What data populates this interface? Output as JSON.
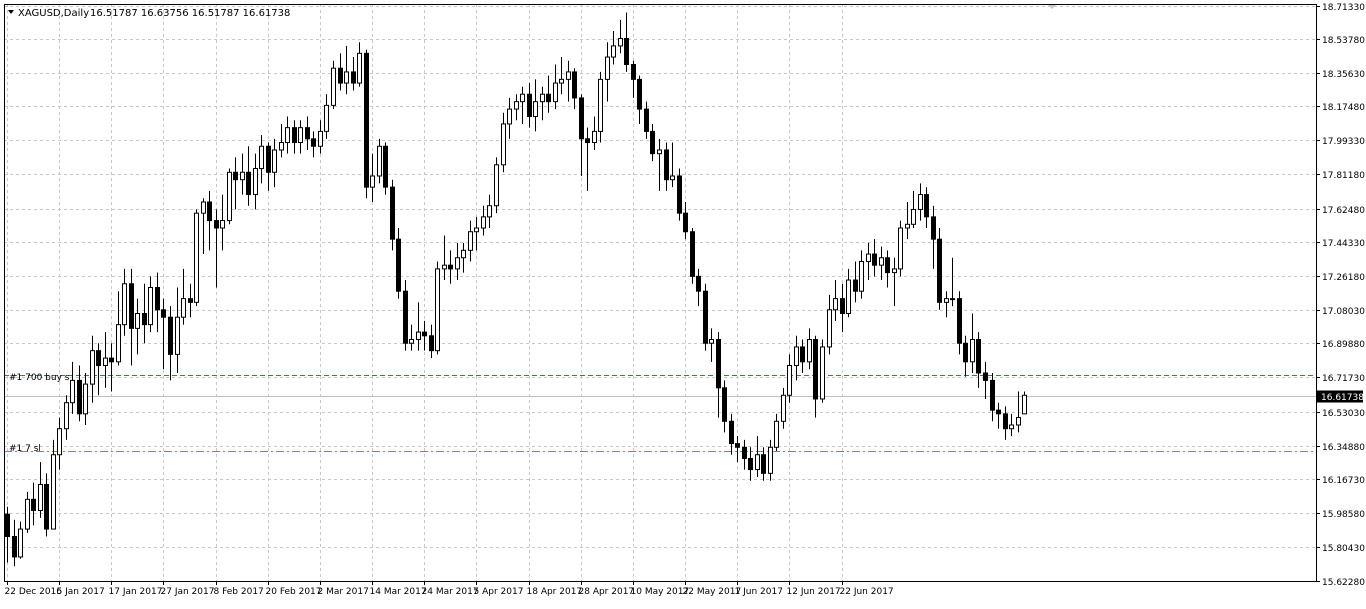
{
  "header": {
    "symbol": "XAGUSD,Daily",
    "ohlc": "16.51787 16.63756 16.51787 16.61738"
  },
  "orders": {
    "buy_label": "#1 700 buy s",
    "sl_label": "#1 7 sl",
    "buy_price": 16.7265,
    "sl_price": 16.3185
  },
  "colors": {
    "background": "#ffffff",
    "grid": "#c8c8c8",
    "bull_body": "#ffffff",
    "bear_body": "#000000",
    "wick": "#000000",
    "buy_line": "#2e8b2e",
    "sl_line": "#e0603a",
    "current_price_line": "#c0c0c0",
    "price_tag_bg": "#000000",
    "price_tag_text": "#ffffff"
  },
  "chart_data": {
    "type": "candlestick",
    "symbol": "XAGUSD",
    "timeframe": "Daily",
    "ylim": [
      15.6205,
      18.7255
    ],
    "y_ticks": [
      "18.71330",
      "18.53780",
      "18.35630",
      "18.17480",
      "17.99330",
      "17.81180",
      "17.62480",
      "17.44330",
      "17.26180",
      "17.08030",
      "16.89880",
      "16.71730",
      "16.53030",
      "16.34880",
      "16.16730",
      "15.98580",
      "15.80430",
      "15.62280"
    ],
    "x_ticks": [
      "22 Dec 2016",
      "5 Jan 2017",
      "17 Jan 2017",
      "27 Jan 2017",
      "8 Feb 2017",
      "20 Feb 2017",
      "2 Mar 2017",
      "14 Mar 2017",
      "24 Mar 2017",
      "5 Apr 2017",
      "18 Apr 2017",
      "28 Apr 2017",
      "10 May 2017",
      "22 May 2017",
      "1 Jun 2017",
      "12 Jun 2017",
      "22 Jun 2017"
    ],
    "current_price": "16.61738",
    "grid": true,
    "series": [
      {
        "candles": [
          [
            15.98,
            15.86,
            16.02,
            15.72
          ],
          [
            15.86,
            15.75,
            15.95,
            15.7
          ],
          [
            15.75,
            15.9,
            15.94,
            15.74
          ],
          [
            15.9,
            16.06,
            16.1,
            15.88
          ],
          [
            16.06,
            16.0,
            16.15,
            15.92
          ],
          [
            16.0,
            16.14,
            16.26,
            15.96
          ],
          [
            16.14,
            15.9,
            16.2,
            15.86
          ],
          [
            15.9,
            16.3,
            16.38,
            15.9
          ],
          [
            16.3,
            16.44,
            16.5,
            16.22
          ],
          [
            16.44,
            16.58,
            16.62,
            16.38
          ],
          [
            16.58,
            16.7,
            16.8,
            16.52
          ],
          [
            16.7,
            16.52,
            16.78,
            16.48
          ],
          [
            16.52,
            16.68,
            16.74,
            16.46
          ],
          [
            16.68,
            16.86,
            16.94,
            16.58
          ],
          [
            16.86,
            16.78,
            16.9,
            16.62
          ],
          [
            16.78,
            16.82,
            16.96,
            16.66
          ],
          [
            16.82,
            16.8,
            16.9,
            16.64
          ],
          [
            16.8,
            17.0,
            17.18,
            16.78
          ],
          [
            17.0,
            17.22,
            17.3,
            16.94
          ],
          [
            17.22,
            16.98,
            17.3,
            16.78
          ],
          [
            16.98,
            17.06,
            17.14,
            16.84
          ],
          [
            17.06,
            17.0,
            17.22,
            16.9
          ],
          [
            17.0,
            17.2,
            17.26,
            16.96
          ],
          [
            17.2,
            17.08,
            17.28,
            16.96
          ],
          [
            17.08,
            17.04,
            17.14,
            16.76
          ],
          [
            17.04,
            16.84,
            17.1,
            16.7
          ],
          [
            16.84,
            17.04,
            17.2,
            16.74
          ],
          [
            17.04,
            17.14,
            17.3,
            17.0
          ],
          [
            17.14,
            17.12,
            17.22,
            17.04
          ],
          [
            17.12,
            17.6,
            17.62,
            17.1
          ],
          [
            17.6,
            17.66,
            17.68,
            17.38
          ],
          [
            17.66,
            17.56,
            17.72,
            17.4
          ],
          [
            17.56,
            17.52,
            17.62,
            17.2
          ],
          [
            17.52,
            17.56,
            17.7,
            17.4
          ],
          [
            17.56,
            17.82,
            17.84,
            17.54
          ],
          [
            17.82,
            17.78,
            17.9,
            17.62
          ],
          [
            17.78,
            17.82,
            17.92,
            17.7
          ],
          [
            17.82,
            17.7,
            17.96,
            17.64
          ],
          [
            17.7,
            17.84,
            17.92,
            17.62
          ],
          [
            17.84,
            17.96,
            18.02,
            17.76
          ],
          [
            17.96,
            17.82,
            17.98,
            17.72
          ],
          [
            17.82,
            17.94,
            18.0,
            17.74
          ],
          [
            17.94,
            17.98,
            18.08,
            17.9
          ],
          [
            17.98,
            18.06,
            18.12,
            17.92
          ],
          [
            18.06,
            17.98,
            18.1,
            17.92
          ],
          [
            17.98,
            18.06,
            18.1,
            17.92
          ],
          [
            18.06,
            18.0,
            18.12,
            17.94
          ],
          [
            18.0,
            17.96,
            18.04,
            17.9
          ],
          [
            17.96,
            18.04,
            18.1,
            17.92
          ],
          [
            18.04,
            18.18,
            18.24,
            18.0
          ],
          [
            18.18,
            18.38,
            18.42,
            18.16
          ],
          [
            18.38,
            18.3,
            18.46,
            18.26
          ],
          [
            18.3,
            18.36,
            18.5,
            18.24
          ],
          [
            18.36,
            18.3,
            18.44,
            18.26
          ],
          [
            18.3,
            18.46,
            18.52,
            18.28
          ],
          [
            18.46,
            17.74,
            18.48,
            17.68
          ],
          [
            17.74,
            17.8,
            17.92,
            17.66
          ],
          [
            17.8,
            17.96,
            18.0,
            17.76
          ],
          [
            17.96,
            17.74,
            17.98,
            17.7
          ],
          [
            17.74,
            17.46,
            17.78,
            17.4
          ],
          [
            17.46,
            17.18,
            17.52,
            17.14
          ],
          [
            17.18,
            16.9,
            17.24,
            16.86
          ],
          [
            16.9,
            16.92,
            17.0,
            16.86
          ],
          [
            16.92,
            16.96,
            17.12,
            16.86
          ],
          [
            16.96,
            16.94,
            17.02,
            16.86
          ],
          [
            16.94,
            16.86,
            17.0,
            16.82
          ],
          [
            16.86,
            17.3,
            17.34,
            16.84
          ],
          [
            17.3,
            17.32,
            17.48,
            17.24
          ],
          [
            17.32,
            17.3,
            17.4,
            17.22
          ],
          [
            17.3,
            17.36,
            17.44,
            17.24
          ],
          [
            17.36,
            17.4,
            17.44,
            17.28
          ],
          [
            17.4,
            17.5,
            17.56,
            17.34
          ],
          [
            17.5,
            17.52,
            17.58,
            17.4
          ],
          [
            17.52,
            17.58,
            17.64,
            17.48
          ],
          [
            17.58,
            17.64,
            17.7,
            17.52
          ],
          [
            17.64,
            17.86,
            17.9,
            17.6
          ],
          [
            17.86,
            18.08,
            18.14,
            17.82
          ],
          [
            18.08,
            18.16,
            18.22,
            18.0
          ],
          [
            18.16,
            18.2,
            18.24,
            18.1
          ],
          [
            18.2,
            18.24,
            18.28,
            18.08
          ],
          [
            18.24,
            18.12,
            18.3,
            18.06
          ],
          [
            18.12,
            18.2,
            18.32,
            18.04
          ],
          [
            18.2,
            18.24,
            18.28,
            18.1
          ],
          [
            18.24,
            18.2,
            18.34,
            18.14
          ],
          [
            18.2,
            18.3,
            18.4,
            18.16
          ],
          [
            18.3,
            18.32,
            18.44,
            18.24
          ],
          [
            18.32,
            18.36,
            18.42,
            18.2
          ],
          [
            18.36,
            18.22,
            18.38,
            18.16
          ],
          [
            18.22,
            18.0,
            18.24,
            17.8
          ],
          [
            18.0,
            17.98,
            18.06,
            17.72
          ],
          [
            17.98,
            18.04,
            18.12,
            17.94
          ],
          [
            18.04,
            18.32,
            18.36,
            17.98
          ],
          [
            18.32,
            18.44,
            18.52,
            18.2
          ],
          [
            18.44,
            18.5,
            18.58,
            18.4
          ],
          [
            18.5,
            18.54,
            18.64,
            18.46
          ],
          [
            18.54,
            18.4,
            18.68,
            18.36
          ],
          [
            18.4,
            18.32,
            18.42,
            18.22
          ],
          [
            18.32,
            18.16,
            18.34,
            18.08
          ],
          [
            18.16,
            18.04,
            18.2,
            18.0
          ],
          [
            18.04,
            17.92,
            18.08,
            17.88
          ],
          [
            17.92,
            17.94,
            18.0,
            17.72
          ],
          [
            17.94,
            17.78,
            17.98,
            17.72
          ],
          [
            17.78,
            17.8,
            17.98,
            17.74
          ],
          [
            17.8,
            17.6,
            17.84,
            17.56
          ],
          [
            17.6,
            17.5,
            17.66,
            17.46
          ],
          [
            17.5,
            17.26,
            17.52,
            17.22
          ],
          [
            17.26,
            17.18,
            17.3,
            17.1
          ],
          [
            17.18,
            16.9,
            17.22,
            16.86
          ],
          [
            16.9,
            16.92,
            16.98,
            16.8
          ],
          [
            16.92,
            16.66,
            16.96,
            16.5
          ],
          [
            16.66,
            16.48,
            16.7,
            16.42
          ],
          [
            16.48,
            16.36,
            16.52,
            16.3
          ],
          [
            16.36,
            16.34,
            16.4,
            16.26
          ],
          [
            16.34,
            16.28,
            16.38,
            16.22
          ],
          [
            16.28,
            16.22,
            16.34,
            16.16
          ],
          [
            16.22,
            16.3,
            16.4,
            16.18
          ],
          [
            16.3,
            16.2,
            16.34,
            16.16
          ],
          [
            16.2,
            16.34,
            16.38,
            16.16
          ],
          [
            16.34,
            16.48,
            16.52,
            16.32
          ],
          [
            16.48,
            16.62,
            16.66,
            16.44
          ],
          [
            16.62,
            16.78,
            16.84,
            16.58
          ],
          [
            16.78,
            16.88,
            16.94,
            16.7
          ],
          [
            16.88,
            16.8,
            16.92,
            16.74
          ],
          [
            16.8,
            16.92,
            16.98,
            16.76
          ],
          [
            16.92,
            16.6,
            16.94,
            16.5
          ],
          [
            16.6,
            16.88,
            16.92,
            16.58
          ],
          [
            16.88,
            17.08,
            17.16,
            16.84
          ],
          [
            17.08,
            17.14,
            17.24,
            17.02
          ],
          [
            17.14,
            17.06,
            17.22,
            16.96
          ],
          [
            17.06,
            17.24,
            17.3,
            17.04
          ],
          [
            17.24,
            17.18,
            17.34,
            17.12
          ],
          [
            17.18,
            17.34,
            17.4,
            17.14
          ],
          [
            17.34,
            17.38,
            17.44,
            17.24
          ],
          [
            17.38,
            17.32,
            17.46,
            17.26
          ],
          [
            17.32,
            17.36,
            17.42,
            17.24
          ],
          [
            17.36,
            17.28,
            17.4,
            17.2
          ],
          [
            17.28,
            17.3,
            17.36,
            17.1
          ],
          [
            17.3,
            17.52,
            17.56,
            17.26
          ],
          [
            17.52,
            17.54,
            17.66,
            17.46
          ],
          [
            17.54,
            17.62,
            17.72,
            17.52
          ],
          [
            17.62,
            17.7,
            17.76,
            17.56
          ],
          [
            17.7,
            17.58,
            17.74,
            17.52
          ],
          [
            17.58,
            17.46,
            17.64,
            17.3
          ],
          [
            17.46,
            17.12,
            17.52,
            17.08
          ],
          [
            17.12,
            17.14,
            17.18,
            17.04
          ],
          [
            17.14,
            17.14,
            17.36,
            17.1
          ],
          [
            17.14,
            16.9,
            17.18,
            16.84
          ],
          [
            16.9,
            16.8,
            16.94,
            16.72
          ],
          [
            16.8,
            16.92,
            17.06,
            16.74
          ],
          [
            16.92,
            16.74,
            16.96,
            16.66
          ],
          [
            16.74,
            16.7,
            16.8,
            16.6
          ],
          [
            16.7,
            16.54,
            16.74,
            16.48
          ],
          [
            16.54,
            16.52,
            16.58,
            16.44
          ],
          [
            16.52,
            16.44,
            16.56,
            16.38
          ],
          [
            16.44,
            16.46,
            16.52,
            16.4
          ],
          [
            16.46,
            16.5,
            16.64,
            16.42
          ],
          [
            16.52,
            16.62,
            16.64,
            16.52
          ]
        ]
      }
    ]
  }
}
